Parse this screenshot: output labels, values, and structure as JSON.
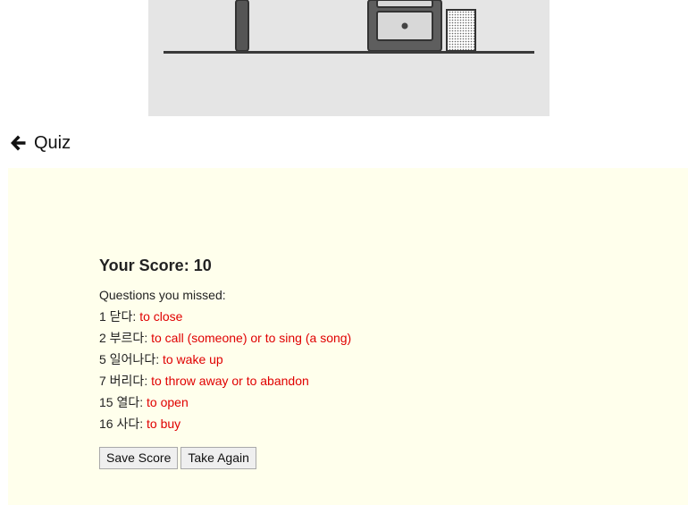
{
  "header": {
    "title": "Quiz"
  },
  "result": {
    "score_text": "Your Score: 10",
    "missed_heading": "Questions you missed:",
    "missed": [
      {
        "prefix": "1 닫다: ",
        "definition": "to close"
      },
      {
        "prefix": "2 부르다: ",
        "definition": "to call (someone) or to sing (a song)"
      },
      {
        "prefix": "5 일어나다: ",
        "definition": "to wake up"
      },
      {
        "prefix": "7 버리다: ",
        "definition": "to throw away or to abandon"
      },
      {
        "prefix": "15 열다: ",
        "definition": "to open"
      },
      {
        "prefix": "16 사다: ",
        "definition": "to buy"
      }
    ]
  },
  "buttons": {
    "save_label": "Save Score",
    "again_label": "Take Again"
  },
  "colors": {
    "panel_background": "#ffffec",
    "missed_definition": "#e00000",
    "illustration_background": "#e5e5e5"
  }
}
